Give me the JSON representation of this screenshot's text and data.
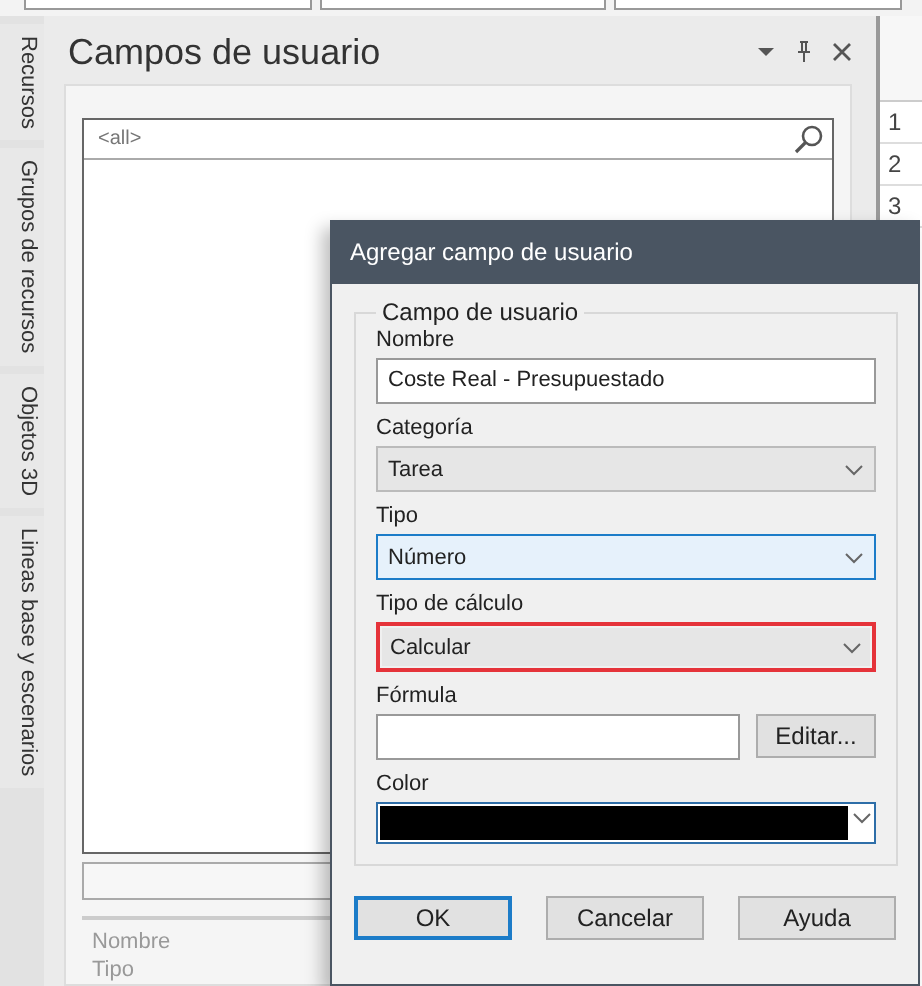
{
  "side_tabs": [
    {
      "label": "Recursos"
    },
    {
      "label": "Grupos de recursos"
    },
    {
      "label": "Objetos 3D"
    },
    {
      "label": "Lineas base y escenarios"
    }
  ],
  "panel": {
    "title": "Campos de usuario",
    "search": {
      "placeholder": "<all>"
    },
    "properties": [
      "Nombre",
      "Tipo"
    ]
  },
  "grid": {
    "rows": [
      "1",
      "2",
      "3"
    ]
  },
  "dialog": {
    "title": "Agregar campo de usuario",
    "group_title": "Campo de usuario",
    "fields": [
      {
        "kind": "text",
        "label": "Nombre",
        "value": "Coste Real - Presupuestado"
      },
      {
        "kind": "select",
        "label": "Categoría",
        "value": "Tarea",
        "focused": false,
        "highlighted": false
      },
      {
        "kind": "select",
        "label": "Tipo",
        "value": "Número",
        "focused": true,
        "highlighted": false
      },
      {
        "kind": "select",
        "label": "Tipo de cálculo",
        "value": "Calcular",
        "focused": false,
        "highlighted": true
      },
      {
        "kind": "formula",
        "label": "Fórmula",
        "button": "Editar..."
      },
      {
        "kind": "color",
        "label": "Color",
        "color": "#000000"
      }
    ],
    "buttons": [
      {
        "label": "OK",
        "default": true
      },
      {
        "label": "Cancelar",
        "default": false
      },
      {
        "label": "Ayuda",
        "default": false
      }
    ]
  }
}
